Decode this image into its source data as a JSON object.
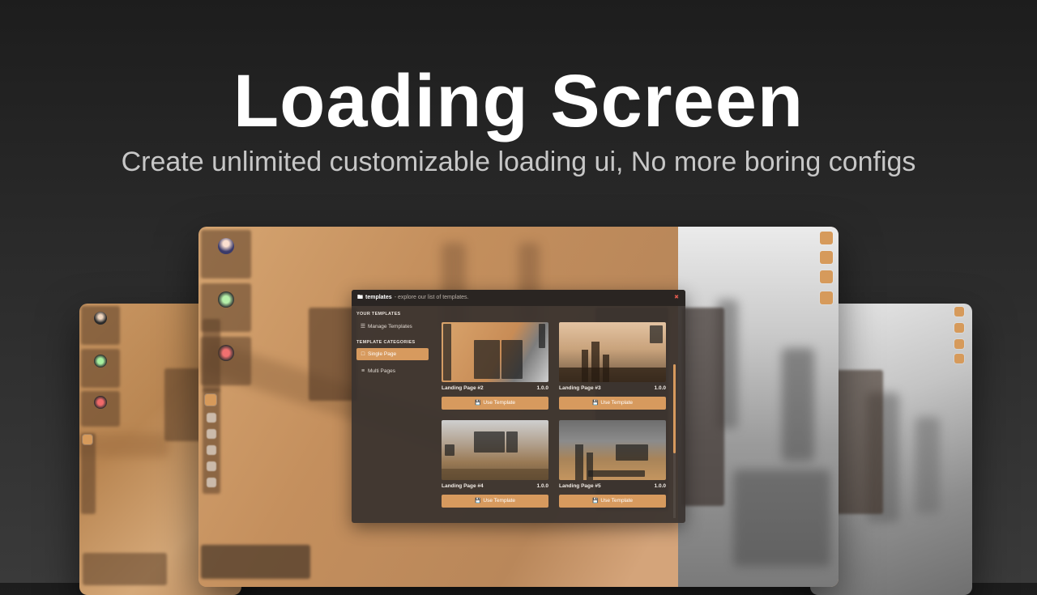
{
  "hero": {
    "title": "Loading Screen",
    "subtitle": "Create unlimited customizable loading ui, No more boring configs"
  },
  "modal": {
    "header_title": "templates",
    "header_subtitle": "- explore our list of templates.",
    "close_icon": "close-icon",
    "sections": {
      "your_templates": "YOUR TEMPLATES",
      "template_categories": "TEMPLATE CATEGORIES"
    },
    "sidebar": [
      {
        "label": "Manage Templates",
        "icon": "database-icon",
        "active": false
      },
      {
        "label": "Single Page",
        "icon": "folder-icon",
        "active": true
      },
      {
        "label": "Multi Pages",
        "icon": "list-icon",
        "active": false
      }
    ],
    "templates": [
      {
        "name": "Landing Page #2",
        "version": "1.0.0",
        "button": "Use Template"
      },
      {
        "name": "Landing Page #3",
        "version": "1.0.0",
        "button": "Use Template"
      },
      {
        "name": "Landing Page #4",
        "version": "1.0.0",
        "button": "Use Template"
      },
      {
        "name": "Landing Page #5",
        "version": "1.0.0",
        "button": "Use Template"
      }
    ]
  },
  "colors": {
    "accent": "#d79a5e",
    "modal_bg": "#38322e",
    "close": "#e05a4e"
  }
}
